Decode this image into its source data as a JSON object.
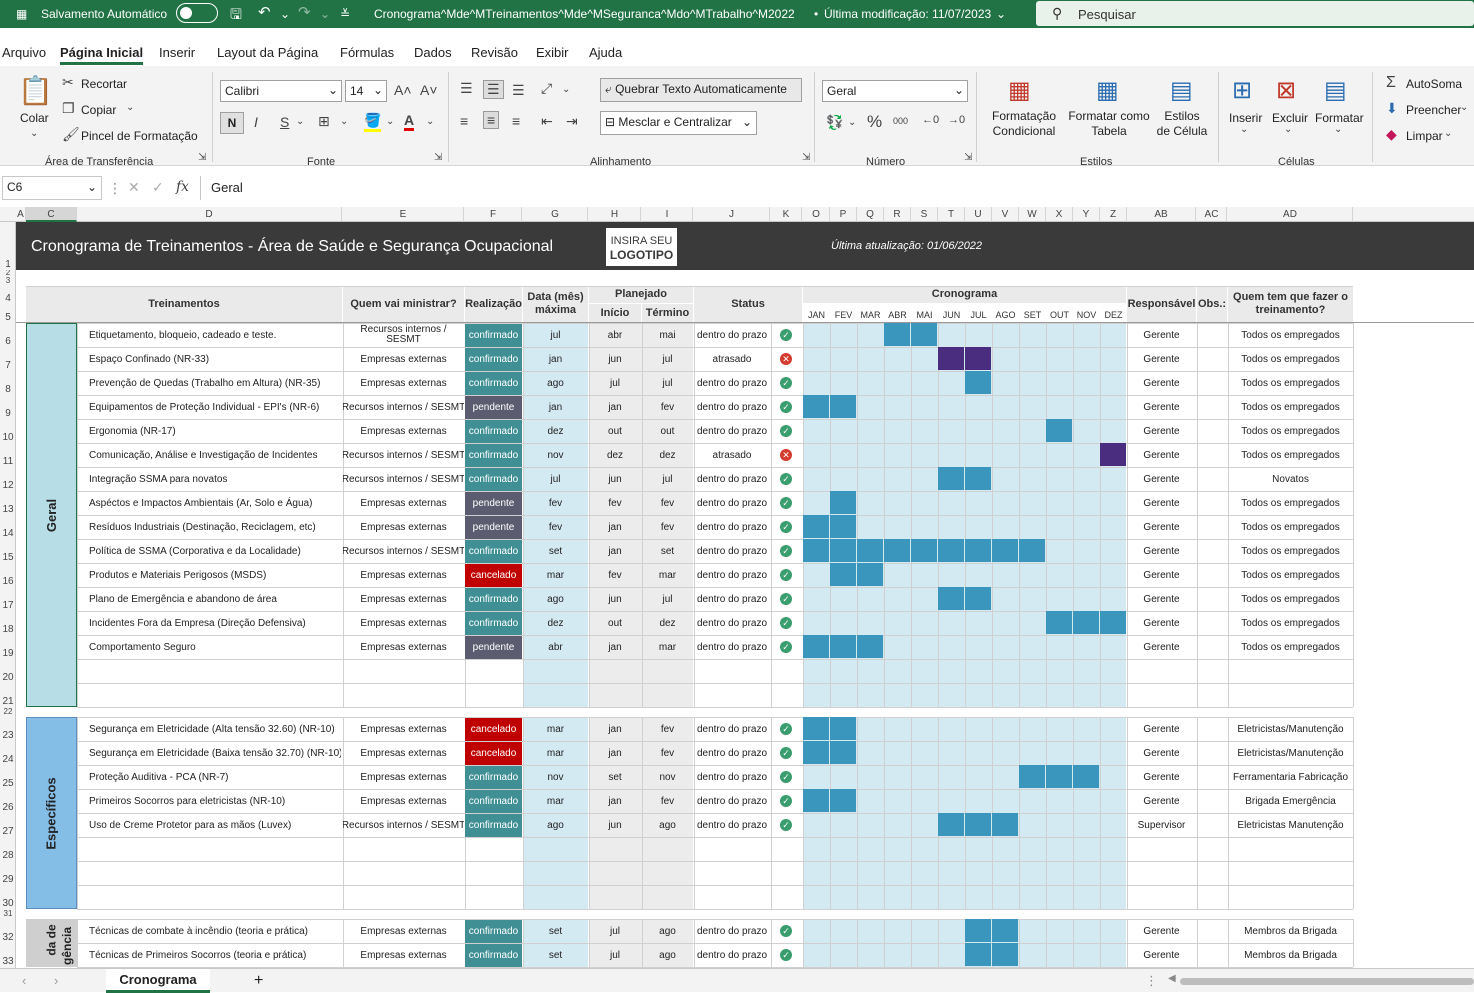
{
  "app": {
    "autosave_label": "Salvamento Automático",
    "doc_title": "Cronograma^Mde^MTreinamentos^Mde^MSeguranca^Mdo^MTrabalho^M2022",
    "modified": "Última modificação: 11/07/2023",
    "search_placeholder": "Pesquisar"
  },
  "menu": [
    "Arquivo",
    "Página Inicial",
    "Inserir",
    "Layout da Página",
    "Fórmulas",
    "Dados",
    "Revisão",
    "Exibir",
    "Ajuda"
  ],
  "ribbon": {
    "clipboard": {
      "paste": "Colar",
      "cut": "Recortar",
      "copy": "Copiar",
      "painter": "Pincel de Formatação",
      "group": "Área de Transferência"
    },
    "font": {
      "name": "Calibri",
      "size": "14",
      "bold": "N",
      "italic": "I",
      "underline": "S",
      "group": "Fonte"
    },
    "alignment": {
      "wrap": "Quebrar Texto Automaticamente",
      "merge": "Mesclar e Centralizar",
      "group": "Alinhamento"
    },
    "number": {
      "format": "Geral",
      "percent": "%",
      "thousands": "000",
      "group": "Número"
    },
    "styles": {
      "cond": "Formatação Condicional",
      "table": "Formatar como Tabela",
      "cell": "Estilos de Célula",
      "group": "Estilos"
    },
    "cells": {
      "insert": "Inserir",
      "delete": "Excluir",
      "format": "Formatar",
      "group": "Células"
    },
    "editing": {
      "autosum": "AutoSoma",
      "fill": "Preencher",
      "clear": "Limpar"
    }
  },
  "formula": {
    "namebox": "C6",
    "fx": "fx",
    "value": "Geral"
  },
  "columns": [
    "A",
    "C",
    "D",
    "E",
    "F",
    "G",
    "H",
    "I",
    "J",
    "K",
    "O",
    "P",
    "Q",
    "R",
    "S",
    "T",
    "U",
    "V",
    "W",
    "X",
    "Y",
    "Z",
    "AB",
    "AC",
    "AD"
  ],
  "rows": [
    "1",
    "2",
    "3",
    "4",
    "5",
    "6",
    "7",
    "8",
    "9",
    "10",
    "11",
    "12",
    "13",
    "14",
    "15",
    "16",
    "17",
    "18",
    "19",
    "20",
    "21",
    "22",
    "23",
    "24",
    "25",
    "26",
    "27",
    "28",
    "29",
    "30",
    "31",
    "32",
    "33"
  ],
  "sheet": {
    "title": "Cronograma de Treinamentos - Área de Saúde e Segurança Ocupacional",
    "logo_line1": "INSIRA SEU",
    "logo_line2": "LOGOTIPO",
    "updated": "Última atualização: 01/06/2022",
    "headers": {
      "treinamentos": "Treinamentos",
      "quem": "Quem vai ministrar?",
      "realizacao": "Realização",
      "data": "Data (mês) máxima",
      "planejado": "Planejado",
      "inicio": "Início",
      "termino": "Término",
      "status": "Status",
      "cronograma": "Cronograma",
      "responsavel": "Responsável",
      "obs": "Obs.:",
      "quem_fazer": "Quem tem que fazer o treinamento?"
    },
    "months": [
      "JAN",
      "FEV",
      "MAR",
      "ABR",
      "MAI",
      "JUN",
      "JUL",
      "AGO",
      "SET",
      "OUT",
      "NOV",
      "DEZ"
    ],
    "sections": [
      {
        "name": "Geral",
        "rows": [
          {
            "t": "Etiquetamento, bloqueio, cadeado  e teste.",
            "q": "Recursos internos / SESMT",
            "r": "confirmado",
            "d": "jul",
            "i": "abr",
            "f": "mai",
            "s": "dentro do prazo",
            "ok": true,
            "g": [
              3,
              4
            ],
            "c": "#3a96bc",
            "resp": "Gerente",
            "who": "Todos os empregados"
          },
          {
            "t": "Espaço Confinado (NR-33)",
            "q": "Empresas externas",
            "r": "confirmado",
            "d": "jan",
            "i": "jun",
            "f": "jul",
            "s": "atrasado",
            "ok": false,
            "g": [
              5,
              6
            ],
            "c": "#4b2d7f",
            "resp": "Gerente",
            "who": "Todos os empregados"
          },
          {
            "t": "Prevenção de Quedas (Trabalho em Altura) (NR-35)",
            "q": "Empresas externas",
            "r": "confirmado",
            "d": "ago",
            "i": "jul",
            "f": "jul",
            "s": "dentro do prazo",
            "ok": true,
            "g": [
              6
            ],
            "c": "#3a96bc",
            "resp": "Gerente",
            "who": "Todos os empregados"
          },
          {
            "t": "Equipamentos de Proteção Individual - EPI's (NR-6)",
            "q": "Recursos internos / SESMT",
            "r": "pendente",
            "d": "jan",
            "i": "jan",
            "f": "fev",
            "s": "dentro do prazo",
            "ok": true,
            "g": [
              0,
              1
            ],
            "c": "#3a96bc",
            "resp": "Gerente",
            "who": "Todos os empregados"
          },
          {
            "t": "Ergonomia (NR-17)",
            "q": "Empresas externas",
            "r": "confirmado",
            "d": "dez",
            "i": "out",
            "f": "out",
            "s": "dentro do prazo",
            "ok": true,
            "g": [
              9
            ],
            "c": "#3a96bc",
            "resp": "Gerente",
            "who": "Todos os empregados"
          },
          {
            "t": "Comunicação, Análise e Investigação de Incidentes",
            "q": "Recursos internos / SESMT",
            "r": "confirmado",
            "d": "nov",
            "i": "dez",
            "f": "dez",
            "s": "atrasado",
            "ok": false,
            "g": [
              11
            ],
            "c": "#4b2d7f",
            "resp": "Gerente",
            "who": "Todos os empregados"
          },
          {
            "t": "Integração SSMA para novatos",
            "q": "Recursos internos / SESMT",
            "r": "confirmado",
            "d": "jul",
            "i": "jun",
            "f": "jul",
            "s": "dentro do prazo",
            "ok": true,
            "g": [
              5,
              6
            ],
            "c": "#3a96bc",
            "resp": "Gerente",
            "who": "Novatos"
          },
          {
            "t": "Aspéctos e Impactos Ambientais (Ar, Solo e Água)",
            "q": "Empresas externas",
            "r": "pendente",
            "d": "fev",
            "i": "fev",
            "f": "fev",
            "s": "dentro do prazo",
            "ok": true,
            "g": [
              1
            ],
            "c": "#3a96bc",
            "resp": "Gerente",
            "who": "Todos os empregados"
          },
          {
            "t": "Resíduos Industriais (Destinação, Reciclagem, etc)",
            "q": "Empresas externas",
            "r": "pendente",
            "d": "fev",
            "i": "jan",
            "f": "fev",
            "s": "dentro do prazo",
            "ok": true,
            "g": [
              0,
              1
            ],
            "c": "#3a96bc",
            "resp": "Gerente",
            "who": "Todos os empregados"
          },
          {
            "t": "Política de SSMA (Corporativa e da Localidade)",
            "q": "Recursos internos / SESMT",
            "r": "confirmado",
            "d": "set",
            "i": "jan",
            "f": "set",
            "s": "dentro do prazo",
            "ok": true,
            "g": [
              0,
              1,
              2,
              3,
              4,
              5,
              6,
              7,
              8
            ],
            "c": "#3a96bc",
            "resp": "Gerente",
            "who": "Todos os empregados"
          },
          {
            "t": "Produtos e Materiais Perigosos (MSDS)",
            "q": "Empresas externas",
            "r": "cancelado",
            "d": "mar",
            "i": "fev",
            "f": "mar",
            "s": "dentro do prazo",
            "ok": true,
            "g": [
              1,
              2
            ],
            "c": "#3a96bc",
            "resp": "Gerente",
            "who": "Todos os empregados"
          },
          {
            "t": "Plano de Emergência e abandono de área",
            "q": "Empresas externas",
            "r": "confirmado",
            "d": "ago",
            "i": "jun",
            "f": "jul",
            "s": "dentro do prazo",
            "ok": true,
            "g": [
              5,
              6
            ],
            "c": "#3a96bc",
            "resp": "Gerente",
            "who": "Todos os empregados"
          },
          {
            "t": "Incidentes Fora da Empresa (Direção Defensiva)",
            "q": "Empresas externas",
            "r": "confirmado",
            "d": "dez",
            "i": "out",
            "f": "dez",
            "s": "dentro do prazo",
            "ok": true,
            "g": [
              9,
              10,
              11
            ],
            "c": "#3a96bc",
            "resp": "Gerente",
            "who": "Todos os empregados"
          },
          {
            "t": "Comportamento Seguro",
            "q": "Empresas externas",
            "r": "pendente",
            "d": "abr",
            "i": "jan",
            "f": "mar",
            "s": "dentro do prazo",
            "ok": true,
            "g": [
              0,
              1,
              2
            ],
            "c": "#3a96bc",
            "resp": "Gerente",
            "who": "Todos os empregados"
          }
        ]
      },
      {
        "name": "Específicos",
        "rows": [
          {
            "t": "Segurança em Eletricidade (Alta tensão 32.60) (NR-10)",
            "q": "Empresas externas",
            "r": "cancelado",
            "d": "mar",
            "i": "jan",
            "f": "fev",
            "s": "dentro do prazo",
            "ok": true,
            "g": [
              0,
              1
            ],
            "c": "#3a96bc",
            "resp": "Gerente",
            "who": "Eletricistas/Manutenção"
          },
          {
            "t": "Segurança em Eletricidade (Baixa tensão 32.70) (NR-10)",
            "q": "Empresas externas",
            "r": "cancelado",
            "d": "mar",
            "i": "jan",
            "f": "fev",
            "s": "dentro do prazo",
            "ok": true,
            "g": [
              0,
              1
            ],
            "c": "#3a96bc",
            "resp": "Gerente",
            "who": "Eletricistas/Manutenção"
          },
          {
            "t": "Proteção Auditiva - PCA (NR-7)",
            "q": "Empresas externas",
            "r": "confirmado",
            "d": "nov",
            "i": "set",
            "f": "nov",
            "s": "dentro do prazo",
            "ok": true,
            "g": [
              8,
              9,
              10
            ],
            "c": "#3a96bc",
            "resp": "Gerente",
            "who": "Ferramentaria Fabricação"
          },
          {
            "t": "Primeiros Socorros para eletricistas (NR-10)",
            "q": "Empresas externas",
            "r": "confirmado",
            "d": "mar",
            "i": "jan",
            "f": "fev",
            "s": "dentro do prazo",
            "ok": true,
            "g": [
              0,
              1
            ],
            "c": "#3a96bc",
            "resp": "Gerente",
            "who": "Brigada Emergência"
          },
          {
            "t": "Uso de Creme Protetor para as mãos (Luvex)",
            "q": "Recursos internos / SESMT",
            "r": "confirmado",
            "d": "ago",
            "i": "jun",
            "f": "ago",
            "s": "dentro do prazo",
            "ok": true,
            "g": [
              5,
              6,
              7
            ],
            "c": "#3a96bc",
            "resp": "Supervisor",
            "who": "Eletricistas Manutenção"
          }
        ]
      },
      {
        "name": "Brigada de Emergência",
        "rows": [
          {
            "t": "Técnicas de combate à incêndio (teoria e prática)",
            "q": "Empresas externas",
            "r": "confirmado",
            "d": "set",
            "i": "jul",
            "f": "ago",
            "s": "dentro do prazo",
            "ok": true,
            "g": [
              6,
              7
            ],
            "c": "#3a96bc",
            "resp": "Gerente",
            "who": "Membros da Brigada"
          },
          {
            "t": "Técnicas de Primeiros Socorros (teoria e prática)",
            "q": "Empresas externas",
            "r": "confirmado",
            "d": "set",
            "i": "jul",
            "f": "ago",
            "s": "dentro do prazo",
            "ok": true,
            "g": [
              6,
              7
            ],
            "c": "#3a96bc",
            "resp": "Gerente",
            "who": "Membros da Brigada"
          }
        ]
      }
    ],
    "side_label_partial": {
      "line1": "da de",
      "line2": "gência"
    }
  },
  "colors": {
    "confirmado": "#3f8f94",
    "pendente": "#5c5c70",
    "cancelado": "#c00000",
    "ontime": "#3a9d6e",
    "late": "#d33b2f",
    "gantt": "#3a96bc",
    "gantt_late": "#4b2d7f"
  },
  "tabs": {
    "active": "Cronograma",
    "add": "+"
  }
}
